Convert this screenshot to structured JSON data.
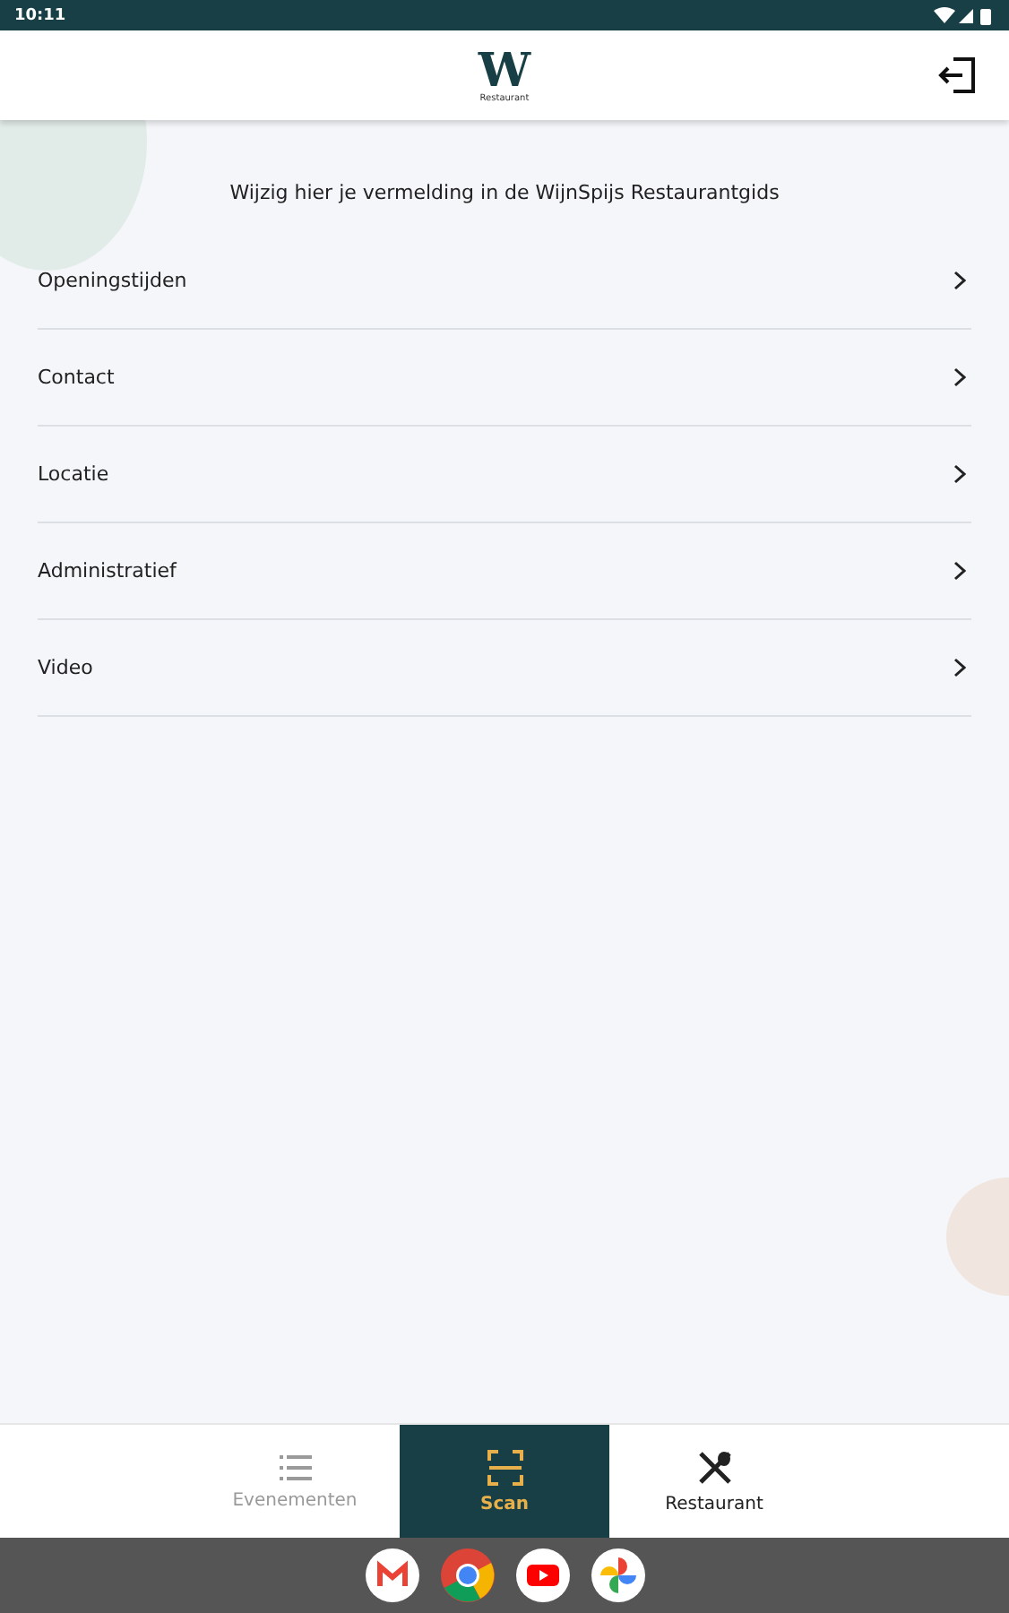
{
  "status_bar": {
    "time": "10:11"
  },
  "header": {
    "logo_letter": "W",
    "logo_subtitle": "Restaurant"
  },
  "intro": "Wijzig hier je vermelding in de WijnSpijs Restaurantgids",
  "menu": [
    {
      "label": "Openingstijden"
    },
    {
      "label": "Contact"
    },
    {
      "label": "Locatie"
    },
    {
      "label": "Administratief"
    },
    {
      "label": "Video"
    }
  ],
  "tabs": [
    {
      "label": "Evenementen",
      "kind": "list",
      "selected": false,
      "disabled": true
    },
    {
      "label": "Scan",
      "kind": "scan",
      "selected": true,
      "disabled": false
    },
    {
      "label": "Restaurant",
      "kind": "cutlery",
      "selected": false,
      "disabled": false
    }
  ],
  "dock": [
    {
      "kind": "mail"
    },
    {
      "kind": "browser"
    },
    {
      "kind": "video"
    },
    {
      "kind": "photos"
    }
  ]
}
